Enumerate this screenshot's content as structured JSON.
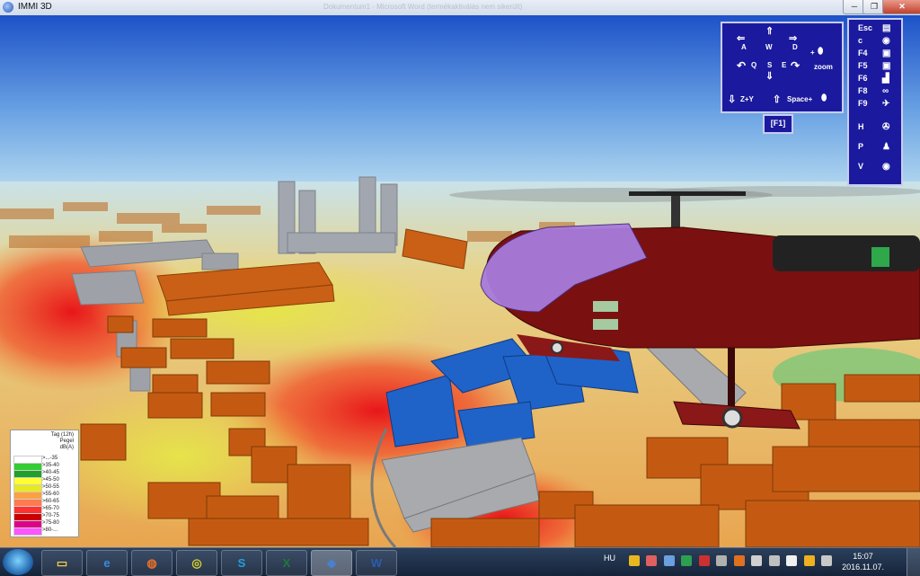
{
  "window": {
    "title": "IMMI 3D",
    "faded_title": "Dokumentum1 - Microsoft Word (termékaktiválás nem sikerült)",
    "min_label": "─",
    "max_label": "❐",
    "close_label": "✕"
  },
  "controls": {
    "keys": {
      "a": "A",
      "w": "W",
      "d": "D",
      "q": "Q",
      "s": "S",
      "e": "E",
      "plus": "+",
      "zoom": "zoom",
      "zy": "Z+Y",
      "space": "Space+"
    },
    "f1": "[F1]",
    "fkeys": [
      {
        "key": "Esc",
        "icon": "▤"
      },
      {
        "key": "c",
        "icon": "◉"
      },
      {
        "key": "F4",
        "icon": "▣"
      },
      {
        "key": "F5",
        "icon": "▣"
      },
      {
        "key": "F6",
        "icon": "▟"
      },
      {
        "key": "F8",
        "icon": "∞"
      },
      {
        "key": "F9",
        "icon": "✈"
      },
      {
        "key": "H",
        "icon": "🚁"
      },
      {
        "key": "P",
        "icon": "♟"
      },
      {
        "key": "V",
        "icon": "◉"
      }
    ]
  },
  "legend": {
    "title1": "Tag (12h)",
    "title2": "Pegel",
    "title3": "dB(A)",
    "items": [
      {
        "label": ">...-35",
        "color": "#ffffff"
      },
      {
        "label": ">35-40",
        "color": "#33cc33"
      },
      {
        "label": ">40-45",
        "color": "#1fa02a"
      },
      {
        "label": ">45-50",
        "color": "#ffff33"
      },
      {
        "label": ">50-55",
        "color": "#e8e820"
      },
      {
        "label": ">55-60",
        "color": "#ffa040"
      },
      {
        "label": ">60-65",
        "color": "#ff7a50"
      },
      {
        "label": ">65-70",
        "color": "#ff3030"
      },
      {
        "label": ">70-75",
        "color": "#cc0000"
      },
      {
        "label": ">75-80",
        "color": "#dd0088"
      },
      {
        "label": ">80-...",
        "color": "#ff55ff"
      }
    ]
  },
  "taskbar": {
    "apps": [
      {
        "name": "explorer",
        "label": "▭"
      },
      {
        "name": "ie",
        "label": "e"
      },
      {
        "name": "firefox",
        "label": "◍"
      },
      {
        "name": "chrome",
        "label": "◎"
      },
      {
        "name": "skype",
        "label": "S"
      },
      {
        "name": "excel",
        "label": "X"
      },
      {
        "name": "immi",
        "label": "◆"
      },
      {
        "name": "word",
        "label": "W"
      }
    ],
    "language": "HU",
    "time": "15:07",
    "date": "2016.11.07."
  },
  "colors": {
    "panel": "#1b1a9e",
    "building_orange": "#c65a14",
    "building_blue": "#1f63c8",
    "building_gray": "#9a9a9a",
    "helicopter_body": "#7a1010"
  }
}
